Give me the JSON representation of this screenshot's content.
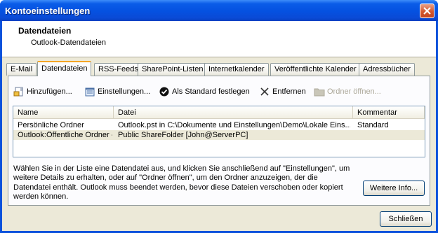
{
  "window": {
    "title": "Kontoeinstellungen"
  },
  "header": {
    "title": "Datendateien",
    "subtitle": "Outlook-Datendateien"
  },
  "tabs": [
    {
      "label": "E-Mail"
    },
    {
      "label": "Datendateien"
    },
    {
      "label": "RSS-Feeds"
    },
    {
      "label": "SharePoint-Listen"
    },
    {
      "label": "Internetkalender"
    },
    {
      "label": "Veröffentlichte Kalender"
    },
    {
      "label": "Adressbücher"
    }
  ],
  "toolbar": {
    "add_label": "Hinzufügen...",
    "settings_label": "Einstellungen...",
    "default_label": "Als Standard festlegen",
    "remove_label": "Entfernen",
    "open_label": "Ordner öffnen..."
  },
  "list": {
    "columns": [
      "Name",
      "Datei",
      "Kommentar"
    ],
    "rows": [
      {
        "name": "Persönliche Ordner",
        "file": "Outlook.pst in C:\\Dokumente und Einstellungen\\Demo\\Lokale Eins...",
        "comment": "Standard"
      },
      {
        "name": "Outlook:Öffentliche Ordner - ...",
        "file": "Public ShareFolder [John@ServerPC]",
        "comment": ""
      }
    ]
  },
  "description": "Wählen Sie in der Liste eine Datendatei aus, und klicken Sie anschließend auf \"Einstellungen\", um weitere Details zu erhalten, oder auf \"Ordner öffnen\", um den Ordner anzuzeigen, der die Datendatei enthält. Outlook muss beendet werden, bevor diese Dateien verschoben oder kopiert werden können.",
  "buttons": {
    "more_info": "Weitere Info...",
    "close": "Schließen"
  }
}
